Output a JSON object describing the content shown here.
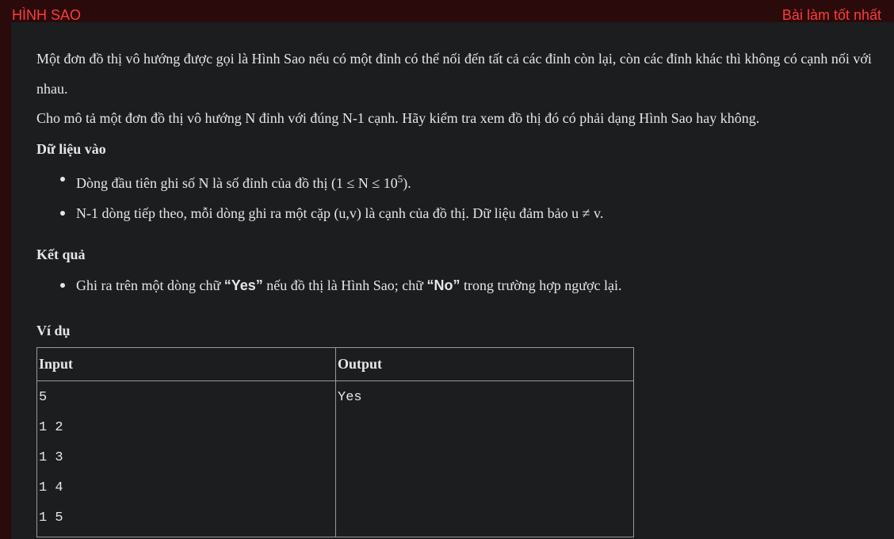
{
  "header": {
    "title": "HÌNH SAO",
    "best_link": "Bài làm tốt nhất"
  },
  "problem": {
    "description": "Một đơn đồ thị vô hướng được gọi là Hình Sao nếu có một đỉnh có thể nối đến tất cả các đỉnh còn lại, còn các đỉnh khác thì không có cạnh nối với nhau.",
    "task": "Cho mô tả một đơn đồ thị vô hướng N đỉnh với đúng N-1 cạnh. Hãy kiểm tra xem đồ thị đó có phải dạng Hình Sao hay không.",
    "input_heading": "Dữ liệu vào",
    "input_items": {
      "first_prefix": "Dòng đầu tiên ghi số N là số đỉnh của đồ thị (1 ≤ N ≤ 10",
      "first_exp": "5",
      "first_suffix": ").",
      "second": "N-1 dòng tiếp theo, mỗi dòng ghi ra một cặp (u,v) là cạnh của đồ thị. Dữ liệu đảm bảo u ≠ v."
    },
    "output_heading": "Kết quả",
    "output_item": {
      "prefix": "Ghi ra trên một dòng chữ ",
      "yes": "“Yes”",
      "middle": " nếu đồ thị là Hình Sao; chữ ",
      "no": "“No”",
      "suffix": " trong trường hợp ngược lại."
    },
    "example_heading": "Ví dụ",
    "example": {
      "headers": [
        "Input",
        "Output"
      ],
      "input_lines": [
        "5",
        "1 2",
        "1 3",
        "1 4",
        "1 5"
      ],
      "output_lines": [
        "Yes"
      ]
    }
  },
  "colors": {
    "accent": "#ff3b3b",
    "header_bg": "#2b0a0b",
    "panel_bg": "#1b1d1f",
    "text": "#e6e6e6",
    "table_border": "#9a9a9a"
  }
}
